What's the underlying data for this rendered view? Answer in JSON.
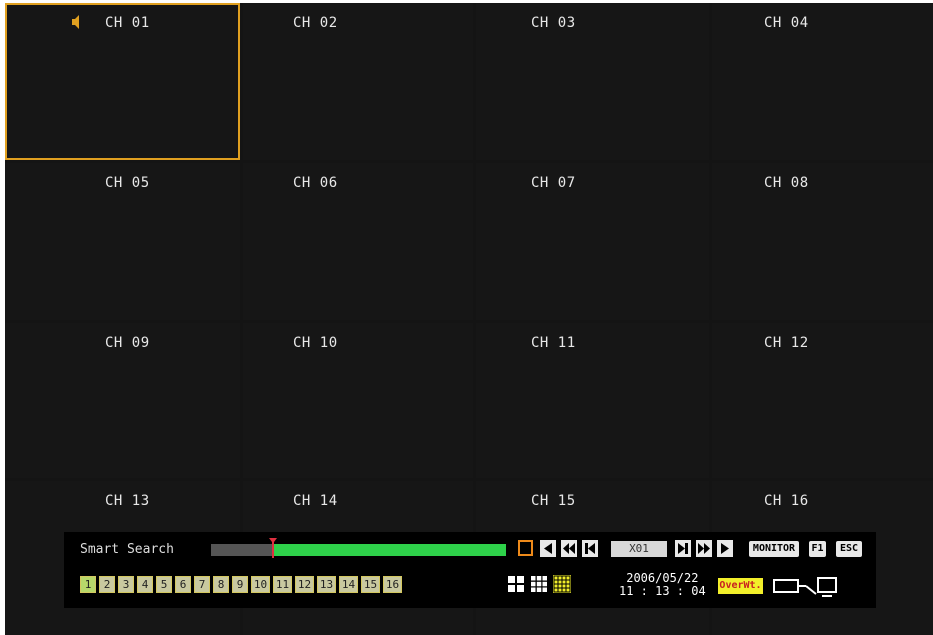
{
  "channels": [
    "CH 01",
    "CH 02",
    "CH 03",
    "CH 04",
    "CH 05",
    "CH 06",
    "CH 07",
    "CH 08",
    "CH 09",
    "CH 10",
    "CH 11",
    "CH 12",
    "CH 13",
    "CH 14",
    "CH 15",
    "CH 16"
  ],
  "selected_channel": "CH 01",
  "control_bar": {
    "mode_label": "Smart Search",
    "speed": "X01",
    "monitor_label": "MONITOR",
    "f1_label": "F1",
    "esc_label": "ESC",
    "date": "2006/05/22",
    "time": "11 : 13 : 04",
    "overwrite_label": "OverWt.",
    "channel_buttons": [
      "1",
      "2",
      "3",
      "4",
      "5",
      "6",
      "7",
      "8",
      "9",
      "10",
      "11",
      "12",
      "13",
      "14",
      "15",
      "16"
    ],
    "active_channel_button": "1"
  },
  "icons": {
    "audio": "speaker-icon",
    "stop": "stop-icon",
    "reverse_play": "reverse-play-icon",
    "fast_rewind": "fast-rewind-icon",
    "step_back": "step-back-icon",
    "step_forward": "step-forward-icon",
    "fast_forward": "fast-forward-icon",
    "play": "play-icon",
    "layout_quad": "quad-layout-icon",
    "layout_9": "nine-split-layout-icon",
    "layout_16": "sixteen-split-layout-icon",
    "output_switch": "output-switch-icon"
  },
  "colors": {
    "selection": "#e0a020",
    "timeline_recorded": "#2ed14a",
    "marker": "#e03040",
    "overwrite_bg": "#f2ef2a"
  }
}
